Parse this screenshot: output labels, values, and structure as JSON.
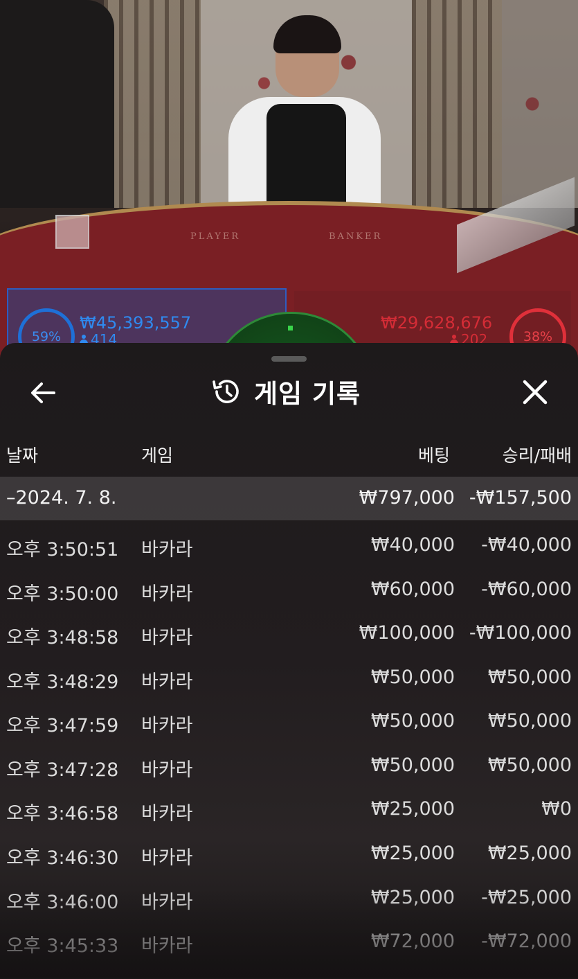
{
  "stream": {
    "table_labels": [
      "PLAYER",
      "BANKER"
    ],
    "player": {
      "percent": "59%",
      "amount": "₩45,393,557",
      "count": "414"
    },
    "banker": {
      "percent": "38%",
      "amount": "₩29,628,676",
      "count": "202"
    }
  },
  "sheet": {
    "title": "게임 기록",
    "icons": {
      "back": "arrow-left-icon",
      "history": "history-icon",
      "close": "close-icon"
    },
    "columns": {
      "date": "날짜",
      "game": "게임",
      "bet": "베팅",
      "win_loss": "승리/패배"
    },
    "group": {
      "date": "–2024. 7. 8.",
      "bet": "₩797,000",
      "win_loss": "-₩157,500"
    },
    "rows": [
      {
        "time": "오후 3:50:51",
        "game": "바카라",
        "bet": "₩40,000",
        "win_loss": "-₩40,000"
      },
      {
        "time": "오후 3:50:00",
        "game": "바카라",
        "bet": "₩60,000",
        "win_loss": "-₩60,000"
      },
      {
        "time": "오후 3:48:58",
        "game": "바카라",
        "bet": "₩100,000",
        "win_loss": "-₩100,000"
      },
      {
        "time": "오후 3:48:29",
        "game": "바카라",
        "bet": "₩50,000",
        "win_loss": "₩50,000"
      },
      {
        "time": "오후 3:47:59",
        "game": "바카라",
        "bet": "₩50,000",
        "win_loss": "₩50,000"
      },
      {
        "time": "오후 3:47:28",
        "game": "바카라",
        "bet": "₩50,000",
        "win_loss": "₩50,000"
      },
      {
        "time": "오후 3:46:58",
        "game": "바카라",
        "bet": "₩25,000",
        "win_loss": "₩0"
      },
      {
        "time": "오후 3:46:30",
        "game": "바카라",
        "bet": "₩25,000",
        "win_loss": "₩25,000"
      },
      {
        "time": "오후 3:46:00",
        "game": "바카라",
        "bet": "₩25,000",
        "win_loss": "-₩25,000"
      },
      {
        "time": "오후 3:45:33",
        "game": "바카라",
        "bet": "₩72,000",
        "win_loss": "-₩72,000"
      }
    ]
  },
  "colors": {
    "player": "#2f8af0",
    "banker": "#d42c36",
    "sheet_bg": "#1d1a1b",
    "dial": "#2e8a38"
  }
}
